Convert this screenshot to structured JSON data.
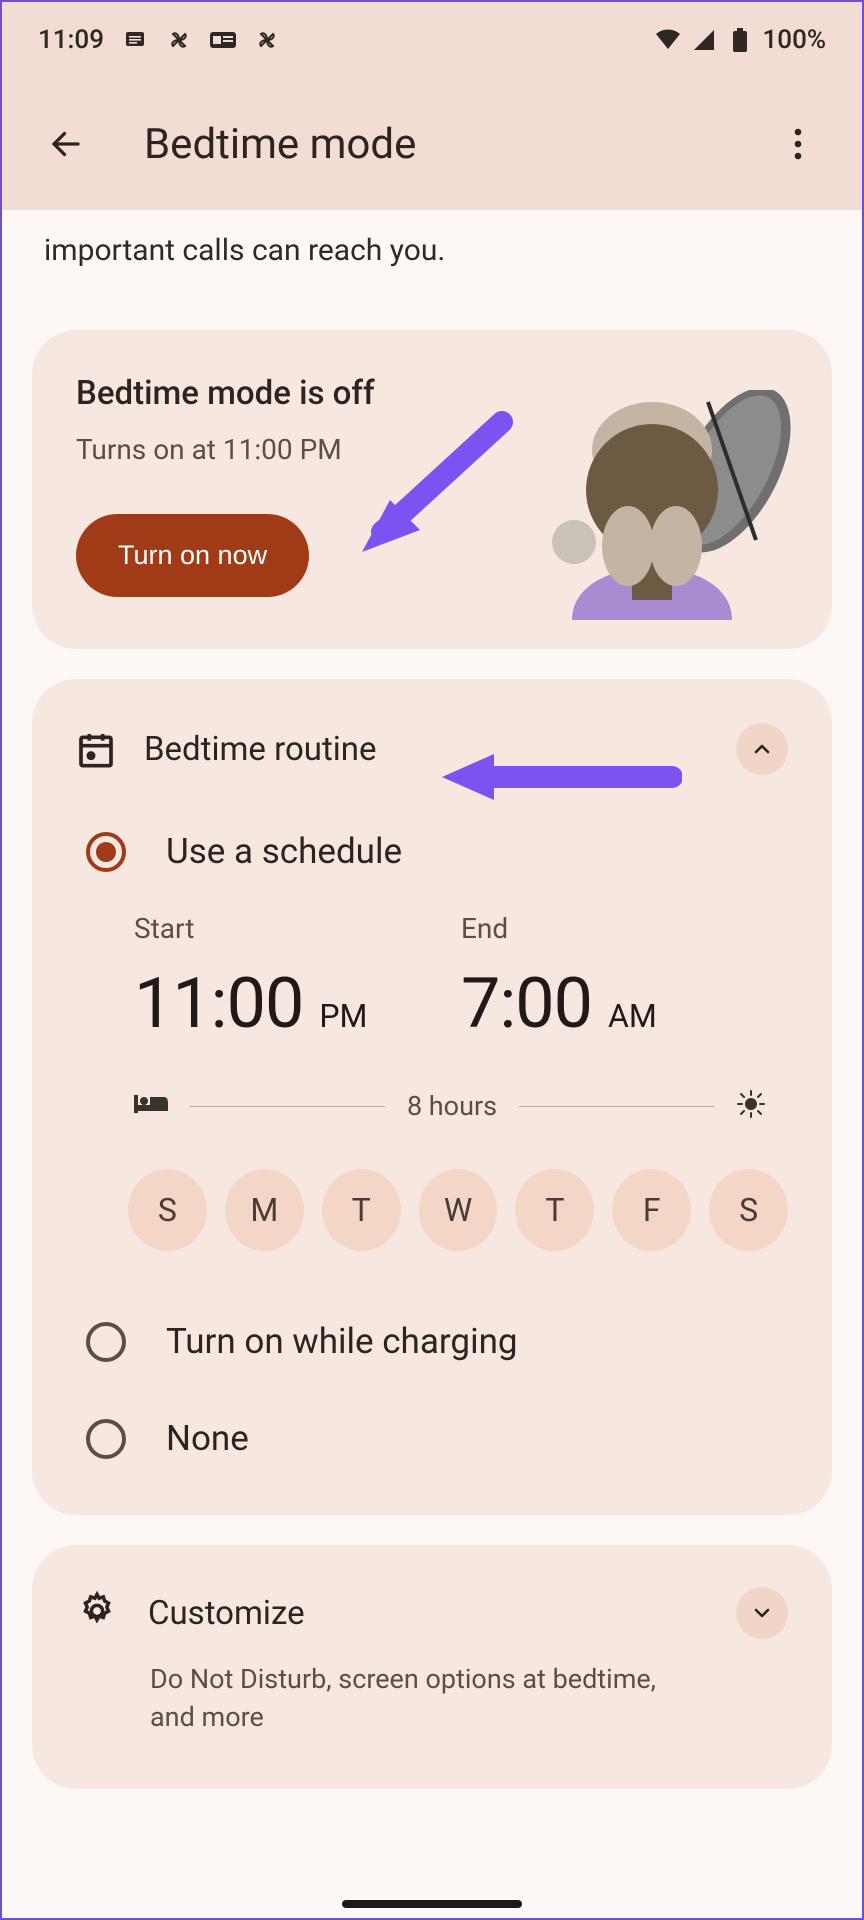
{
  "status": {
    "time": "11:09",
    "battery": "100%"
  },
  "appbar": {
    "title": "Bedtime mode"
  },
  "intro": "important calls can reach you.",
  "offcard": {
    "title": "Bedtime mode is off",
    "subtitle": "Turns on at 11:00 PM",
    "button": "Turn on now"
  },
  "routine": {
    "title": "Bedtime routine",
    "options": {
      "schedule": "Use a schedule",
      "charging": "Turn on while charging",
      "none": "None"
    },
    "start_label": "Start",
    "end_label": "End",
    "start_time": "11:00",
    "start_ampm": "PM",
    "end_time": "7:00",
    "end_ampm": "AM",
    "duration": "8 hours",
    "days": [
      "S",
      "M",
      "T",
      "W",
      "T",
      "F",
      "S"
    ]
  },
  "customize": {
    "title": "Customize",
    "desc": "Do Not Disturb, screen options at bedtime, and more"
  }
}
